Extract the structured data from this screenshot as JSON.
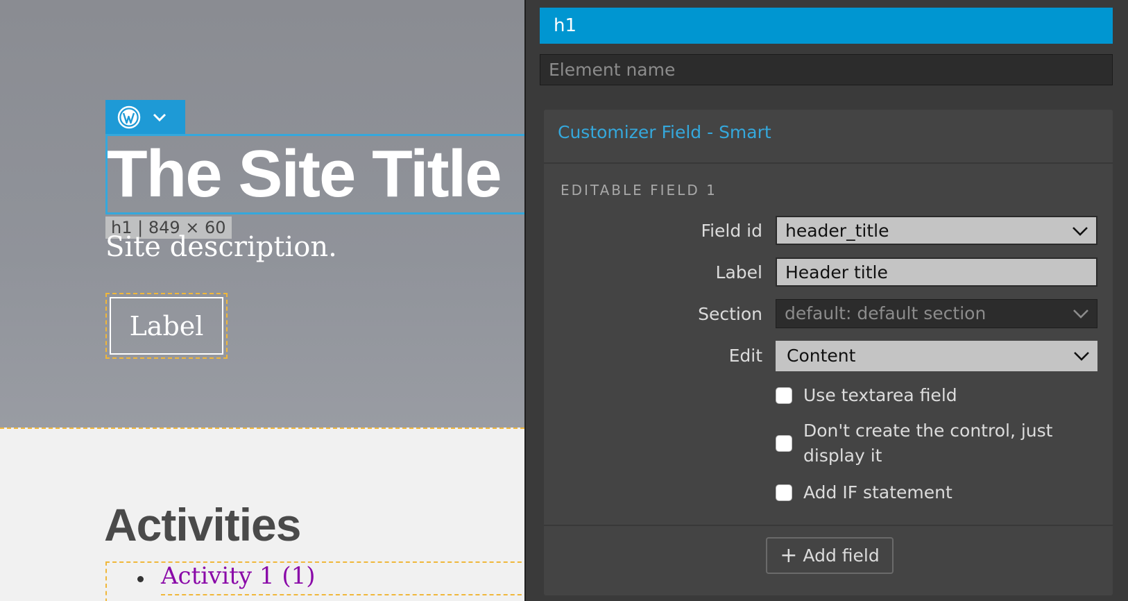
{
  "preview": {
    "site_title": "The Site Title",
    "dimension_tag": "h1 | 849 × 60",
    "site_description": "Site description.",
    "label_button": "Label",
    "activities_heading": "Activities",
    "list_items": [
      "Activity 1 (1)"
    ]
  },
  "panel": {
    "selected_tag": "h1",
    "element_name_placeholder": "Element name",
    "card_title": "Customizer Field - Smart",
    "section_heading": "EDITABLE FIELD 1",
    "fields": {
      "field_id": {
        "label": "Field id",
        "value": "header_title"
      },
      "label": {
        "label": "Label",
        "value": "Header title"
      },
      "section": {
        "label": "Section",
        "value": "default: default section"
      },
      "edit": {
        "label": "Edit",
        "value": "Content"
      }
    },
    "checkboxes": [
      {
        "label": "Use textarea field",
        "checked": false
      },
      {
        "label": "Don't create the control, just display it",
        "checked": false
      },
      {
        "label": "Add IF statement",
        "checked": false
      }
    ],
    "add_field_label": "Add field"
  },
  "colors": {
    "accent_blue": "#0096d1",
    "link_blue": "#35a8dc",
    "dashed_outline": "#f0b73a",
    "link_purple": "#8a0aa8"
  }
}
